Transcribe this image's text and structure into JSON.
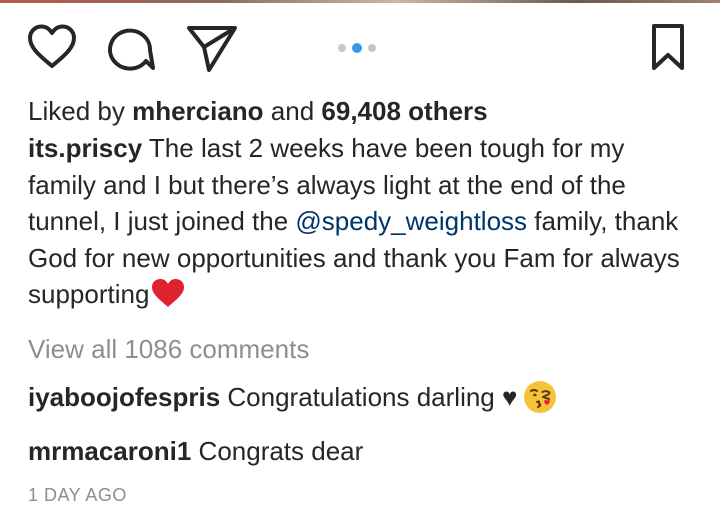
{
  "actions": {
    "like_icon": "heart-outline",
    "comment_icon": "speech-bubble",
    "share_icon": "paper-plane",
    "save_icon": "bookmark-outline",
    "carousel": {
      "total": 3,
      "active_index": 1
    }
  },
  "likes": {
    "prefix": "Liked by ",
    "user": "mherciano",
    "middle": " and ",
    "count": "69,408 others"
  },
  "caption": {
    "username": "its.priscy",
    "text_before_mention": " The last 2 weeks have been tough for my family and I but there’s always light at the end of the tunnel, I just joined the ",
    "mention": "@spedy_weightloss",
    "text_after_mention": " family, thank God for new opportunities and thank you Fam for always supporting"
  },
  "view_all_comments": "View all 1086 comments",
  "comments": [
    {
      "username": "iyaboojofespris",
      "text": " Congratulations darling ♥"
    },
    {
      "username": "mrmacaroni1",
      "text": " Congrats dear"
    }
  ],
  "timestamp": "1 DAY AGO",
  "colors": {
    "text": "#262626",
    "muted": "#8e8e8e",
    "mention": "#003569",
    "carousel_active": "#3897f0",
    "carousel_inactive": "#c7c7c7",
    "heart_emoji": "#e0212f"
  }
}
